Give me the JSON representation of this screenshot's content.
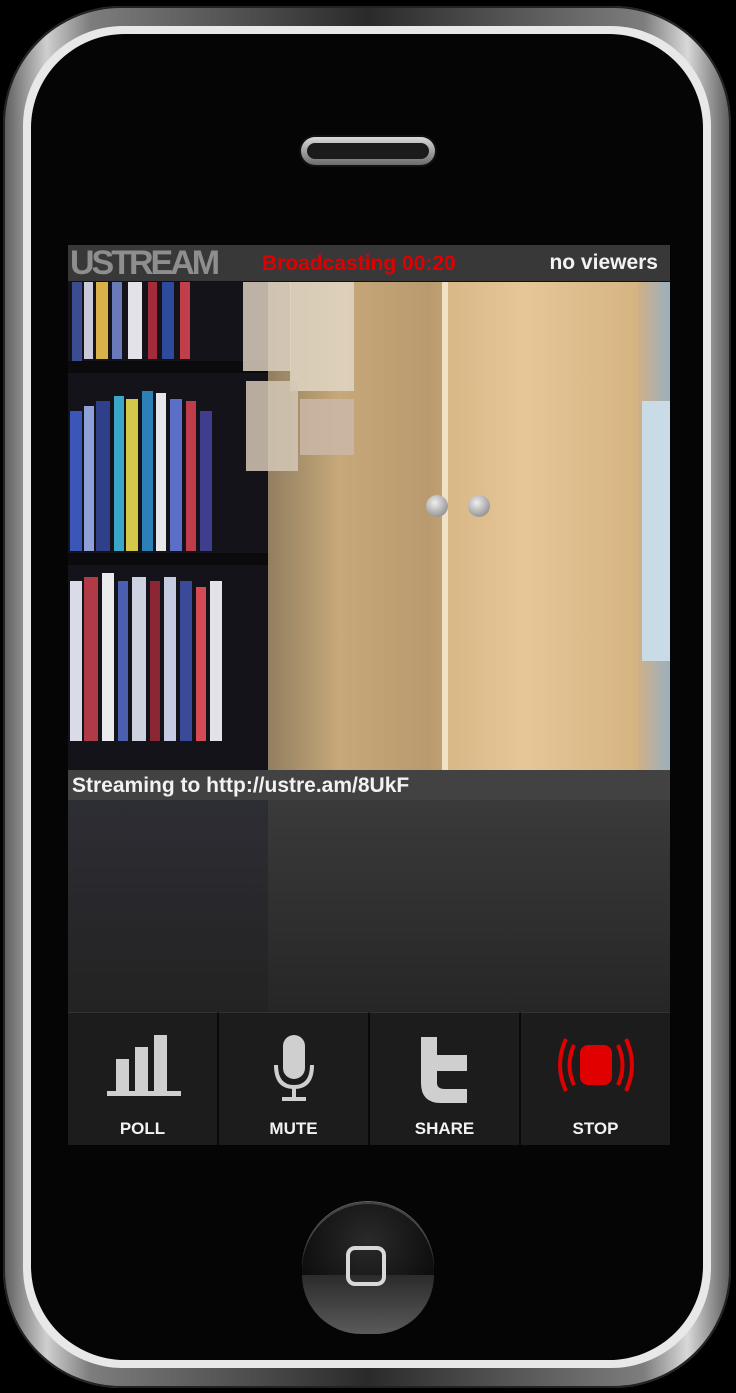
{
  "status_bar": {
    "logo": "USTREAM",
    "broadcasting": "Broadcasting 00:20",
    "viewers": "no viewers"
  },
  "stream": {
    "text": "Streaming to http://ustre.am/8UkF"
  },
  "toolbar": {
    "items": [
      {
        "label": "POLL",
        "icon": "bar-chart-icon"
      },
      {
        "label": "MUTE",
        "icon": "microphone-icon"
      },
      {
        "label": "SHARE",
        "icon": "twitter-icon"
      },
      {
        "label": "STOP",
        "icon": "broadcast-stop-icon"
      }
    ]
  },
  "colors": {
    "broadcasting": "#e00000",
    "stop": "#e00000",
    "icon_grey": "#cfcfcf"
  }
}
